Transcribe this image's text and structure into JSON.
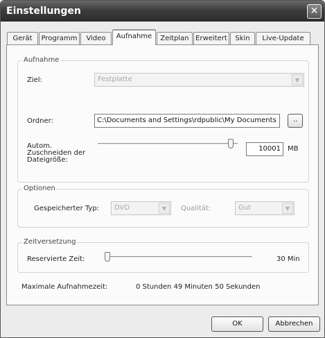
{
  "window": {
    "title": "Einstellungen",
    "close_glyph": "✕"
  },
  "tabs": [
    {
      "label": "Gerät"
    },
    {
      "label": "Programm"
    },
    {
      "label": "Video"
    },
    {
      "label": "Aufnahme",
      "active": true
    },
    {
      "label": "Zeitplan"
    },
    {
      "label": "Erweitert"
    },
    {
      "label": "Skin"
    },
    {
      "label": "Live-Update"
    }
  ],
  "aufnahme": {
    "group_label": "Aufnahme",
    "ziel_label": "Ziel:",
    "ziel_value": "Festplatte",
    "ordner_label": "Ordner:",
    "ordner_value": "C:\\Documents and Settings\\rdpublic\\My Documents",
    "browse_label": "..",
    "truncate_label_line1": "Autom.",
    "truncate_label_line2": "Zuschneiden der",
    "truncate_label_line3": "Dateigröße:",
    "truncate_value": "10001",
    "truncate_unit": "MB",
    "truncate_slider_level": 1.0
  },
  "optionen": {
    "group_label": "Optionen",
    "typ_label": "Gespeicherter Typ:",
    "typ_value": "DVD",
    "qualitaet_label": "Qualität:",
    "qualitaet_value": "Gut"
  },
  "zeitversetzung": {
    "group_label": "Zeitversetzung",
    "reserved_label": "Reservierte Zeit:",
    "reserved_value": "30 Min",
    "reserved_slider_level": 0.0
  },
  "max_time": {
    "label": "Maximale Aufnahmezeit:",
    "value": "0 Stunden 49 Minuten 50 Sekunden"
  },
  "buttons": {
    "ok": "OK",
    "cancel": "Abbrechen"
  },
  "icons": {
    "close": "close-icon",
    "dropdown": "chevron-down-icon"
  }
}
